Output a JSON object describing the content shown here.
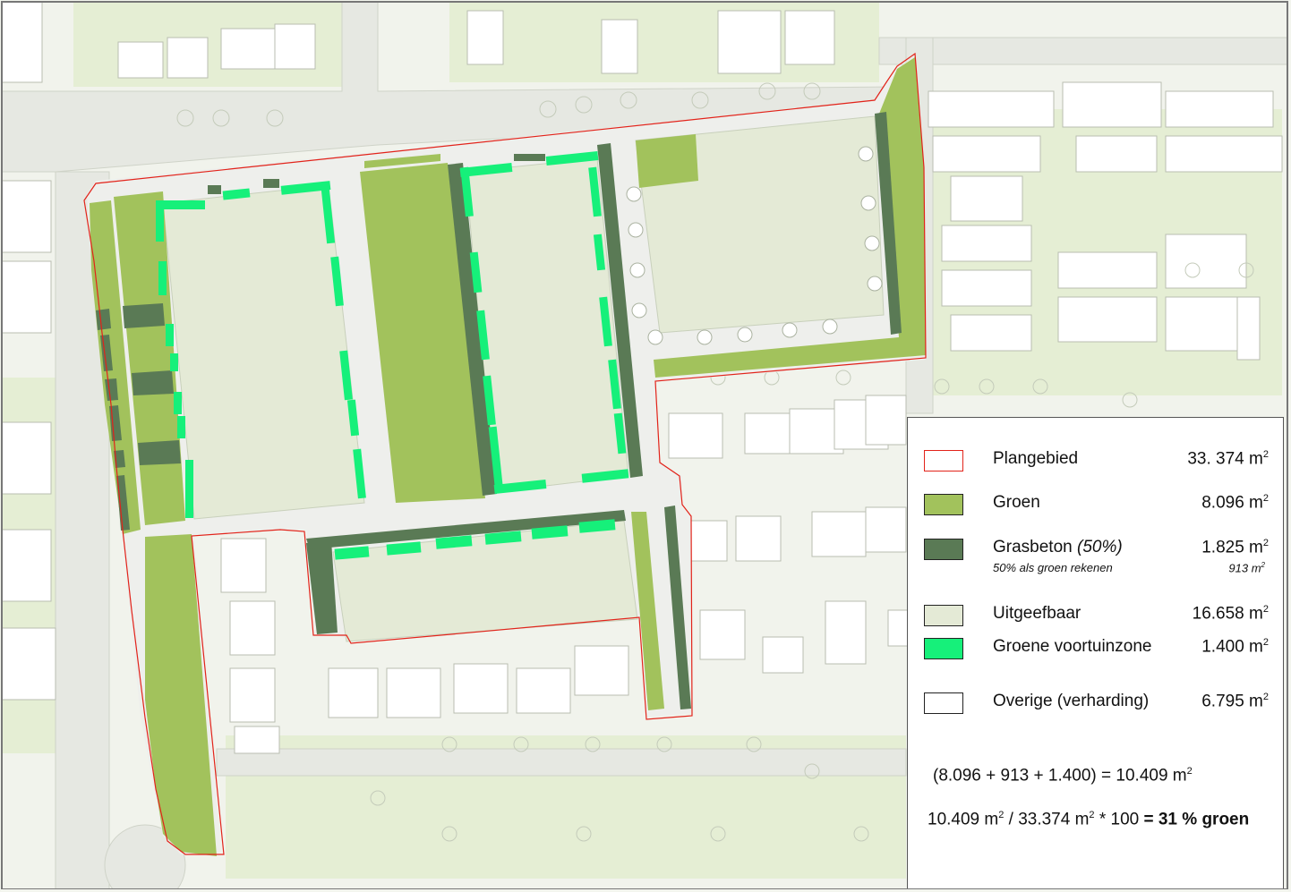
{
  "legend": {
    "items": [
      {
        "key": "plangebied",
        "label": "Plangebied",
        "value": "33. 374",
        "unit": "m",
        "exp": "2",
        "color": "#ffffff",
        "border": "#e2231a"
      },
      {
        "key": "groen",
        "label": "Groen",
        "value": "8.096",
        "unit": "m",
        "exp": "2",
        "color": "#a2c25c",
        "border": "#222222"
      },
      {
        "key": "grasbeton",
        "label": "Grasbeton",
        "label_note": "(50%)",
        "value": "1.825",
        "unit": "m",
        "exp": "2",
        "color": "#5a7a55",
        "border": "#222222",
        "sub_label": "50% als groen rekenen",
        "sub_value": "913 m",
        "sub_exp": "2"
      },
      {
        "key": "uitgeefbaar",
        "label": "Uitgeefbaar",
        "value": "16.658",
        "unit": "m",
        "exp": "2",
        "color": "#e4ead6",
        "border": "#222222"
      },
      {
        "key": "voortuin",
        "label": "Groene voortuinzone",
        "value": "1.400",
        "unit": "m",
        "exp": "2",
        "color": "#16f07a",
        "border": "#222222"
      },
      {
        "key": "overige",
        "label": "Overige (verharding)",
        "value": "6.795",
        "unit": "m",
        "exp": "2",
        "color": "#ffffff",
        "border": "#222222"
      }
    ],
    "calc1": {
      "text": "(8.096 + 913 + 1.400) = 10.409 m",
      "exp": "2"
    },
    "calc2": {
      "part1": "10.409 m",
      "exp1": "2",
      "part2": " / 33.374 m",
      "exp2": "2",
      "part3": " * 100 ",
      "bold": "= 31 % groen"
    }
  },
  "colors": {
    "groen": "#a2c25c",
    "grasbeton": "#5a7a55",
    "uitgeefbaar": "#e4ead6",
    "voortuin": "#16f07a",
    "boundary": "#e2231a",
    "road": "#e9ebe6",
    "context_green": "#e6efd6",
    "building": "#ffffff"
  }
}
